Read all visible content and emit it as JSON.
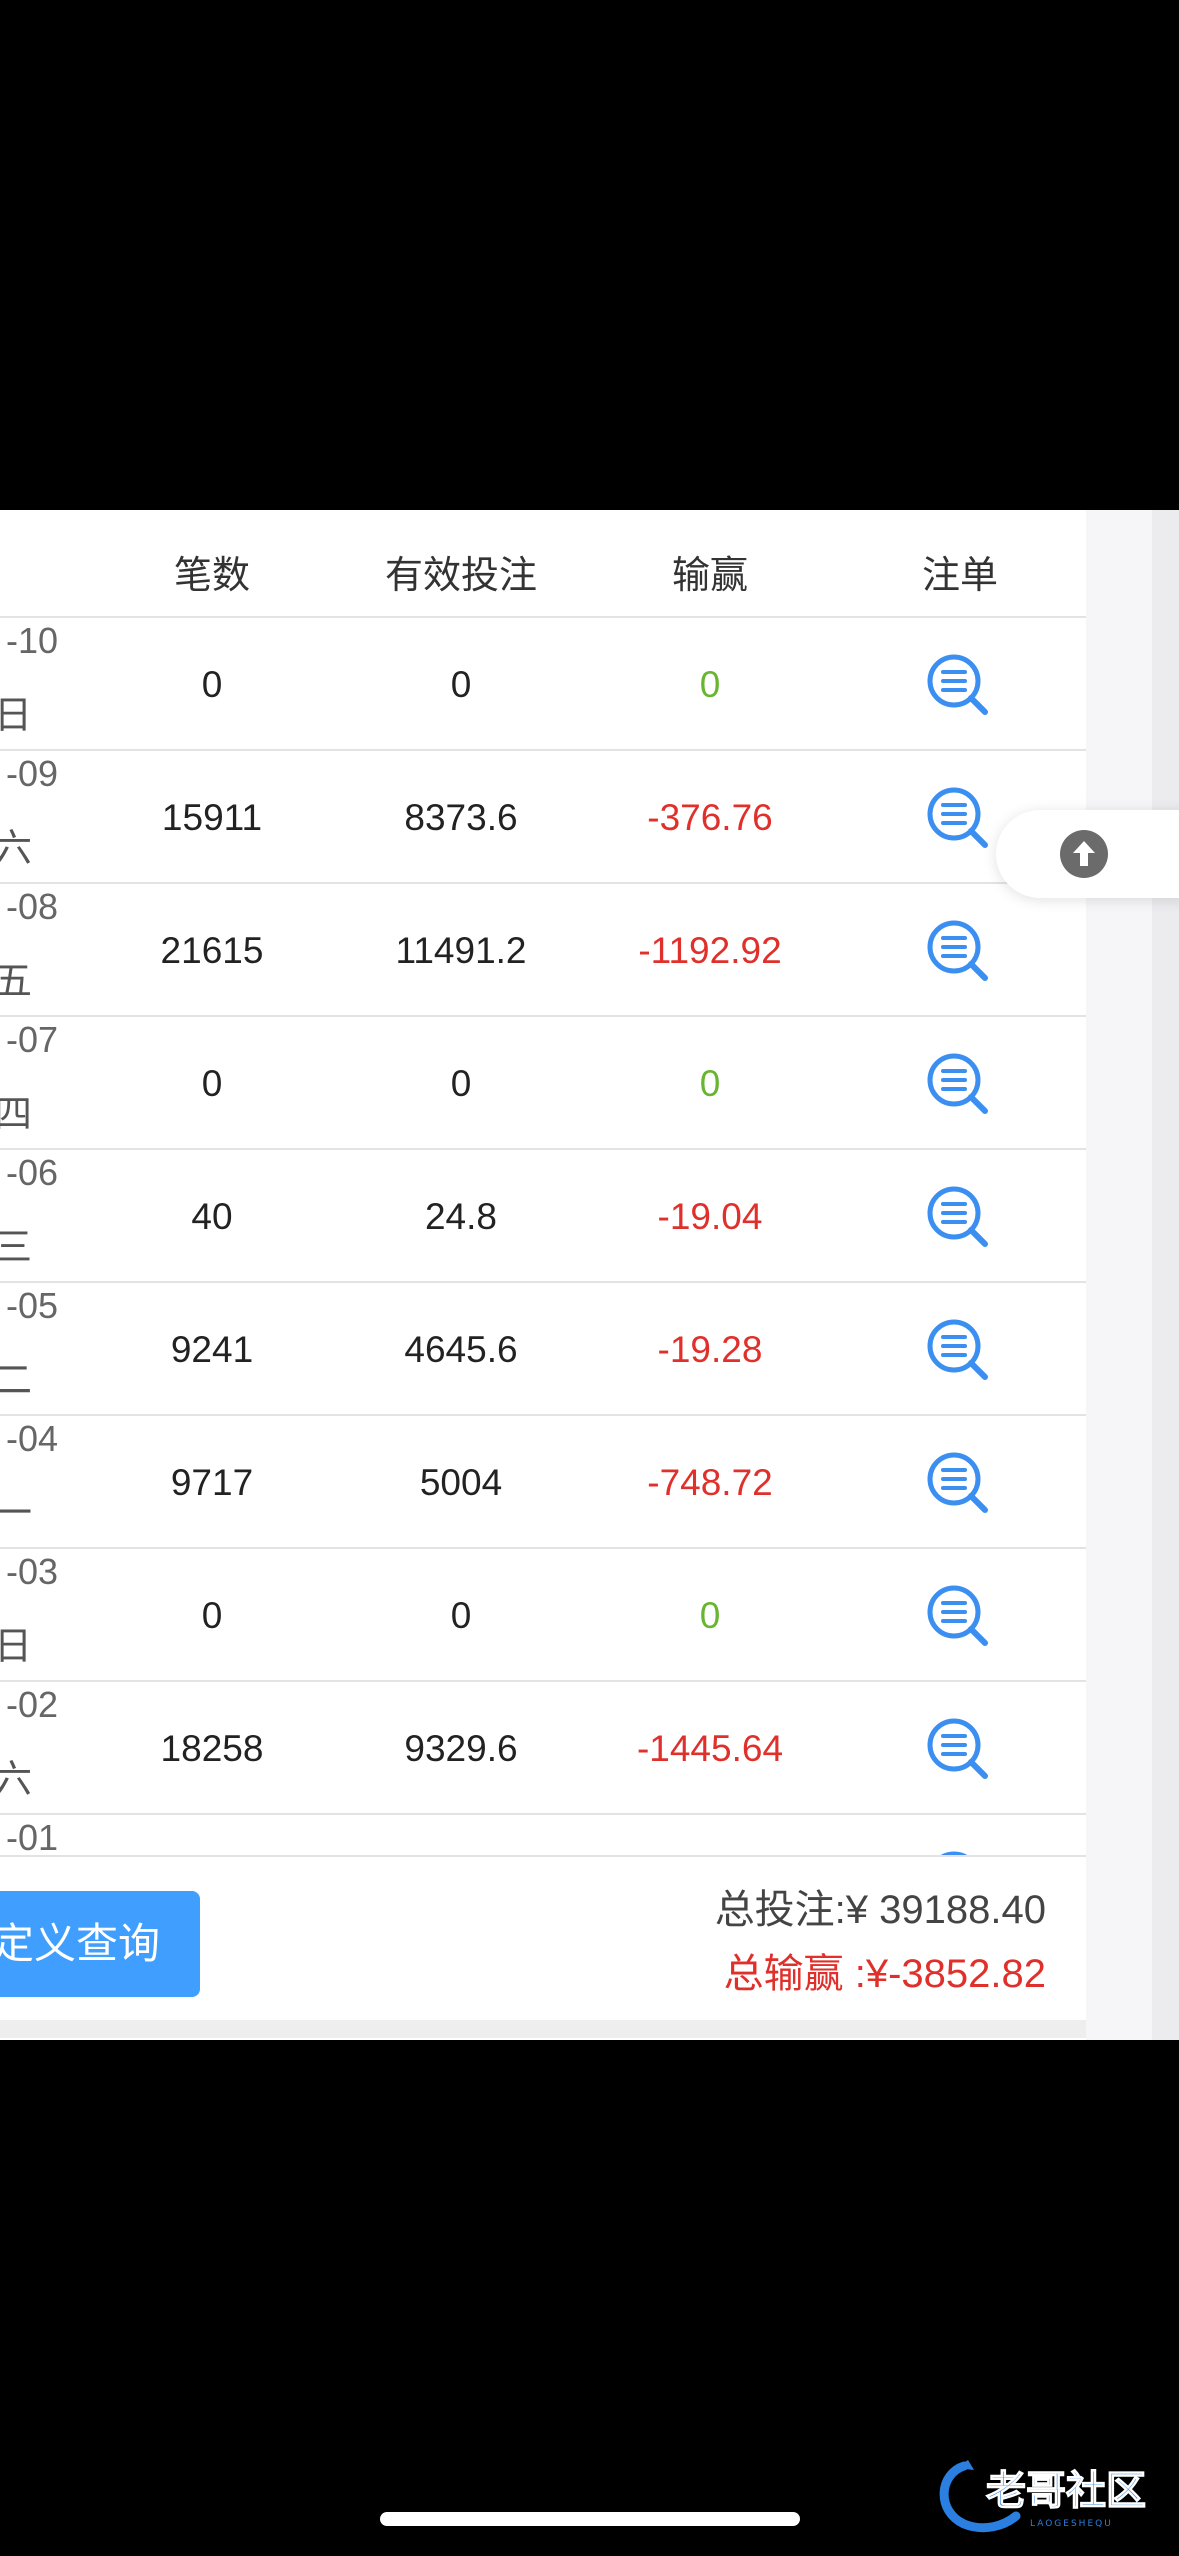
{
  "table": {
    "headers": {
      "count": "笔数",
      "valid_bet": "有效投注",
      "win_loss": "输赢",
      "detail": "注单"
    },
    "rows": [
      {
        "date": "-10",
        "weekday": "日",
        "count": "0",
        "valid_bet": "0",
        "win_loss": "0",
        "sign": "zero"
      },
      {
        "date": "-09",
        "weekday": "六",
        "count": "15911",
        "valid_bet": "8373.6",
        "win_loss": "-376.76",
        "sign": "neg"
      },
      {
        "date": "-08",
        "weekday": "五",
        "count": "21615",
        "valid_bet": "11491.2",
        "win_loss": "-1192.92",
        "sign": "neg"
      },
      {
        "date": "-07",
        "weekday": "四",
        "count": "0",
        "valid_bet": "0",
        "win_loss": "0",
        "sign": "zero"
      },
      {
        "date": "-06",
        "weekday": "三",
        "count": "40",
        "valid_bet": "24.8",
        "win_loss": "-19.04",
        "sign": "neg"
      },
      {
        "date": "-05",
        "weekday": "二",
        "count": "9241",
        "valid_bet": "4645.6",
        "win_loss": "-19.28",
        "sign": "neg"
      },
      {
        "date": "-04",
        "weekday": "一",
        "count": "9717",
        "valid_bet": "5004",
        "win_loss": "-748.72",
        "sign": "neg"
      },
      {
        "date": "-03",
        "weekday": "日",
        "count": "0",
        "valid_bet": "0",
        "win_loss": "0",
        "sign": "zero"
      },
      {
        "date": "-02",
        "weekday": "六",
        "count": "18258",
        "valid_bet": "9329.6",
        "win_loss": "-1445.64",
        "sign": "neg"
      },
      {
        "date": "-01",
        "weekday": "",
        "count": "",
        "valid_bet": "",
        "win_loss": "",
        "sign": "neg"
      }
    ]
  },
  "footer": {
    "custom_query_label": "定义查询",
    "total_bet": "总投注:¥ 39188.40",
    "total_win_loss": "总输赢 :¥-3852.82"
  },
  "watermark": {
    "text": "老哥社区",
    "subtext": "LAOGESHEQU"
  },
  "colors": {
    "accent_blue": "#409eff",
    "win_zero_green": "#67b530",
    "loss_red": "#e0302b",
    "icon_blue": "#3b8ff0"
  },
  "icons": {
    "detail": "search-list-icon",
    "back_to_top": "arrow-up-circle-icon"
  }
}
